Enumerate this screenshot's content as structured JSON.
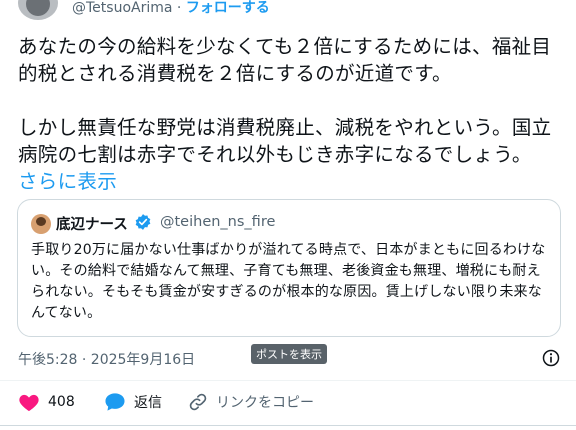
{
  "author": {
    "handle": "@TetsuoArima",
    "separator": "·",
    "follow_label": "フォローする"
  },
  "post": {
    "paragraph1": "あなたの今の給料を少なくても２倍にするためには、福祉目的税とされる消費税を２倍にするのが近道です。",
    "paragraph2": "しかし無責任な野党は消費税廃止、減税をやれという。国立病院の七割は赤字でそれ以外もじき赤字になるでしょう。",
    "show_more": "さらに表示"
  },
  "quote": {
    "name": "底辺ナース",
    "handle": "@teihen_ns_fire",
    "text": "手取り20万に届かない仕事ばかりが溢れてる時点で、日本がまともに回るわけない。その給料で結婚なんて無理、子育ても無理、老後資金も無理、増税にも耐えられない。そもそも賃金が安すぎるのが根本的な原因。賃上げしない限り未来なんてない。"
  },
  "meta": {
    "timestamp": "午後5:28 · 2025年9月16日",
    "tooltip": "ポストを表示"
  },
  "actions": {
    "like_count": "408",
    "reply_label": "返信",
    "copy_link_label": "リンクをコピー"
  },
  "colors": {
    "accent": "#1d9bf0",
    "like": "#f91880",
    "secondary_text": "#536471"
  },
  "icons": [
    "avatar",
    "verified-badge-icon",
    "info-icon",
    "heart-icon",
    "reply-bubble-icon",
    "link-icon"
  ]
}
